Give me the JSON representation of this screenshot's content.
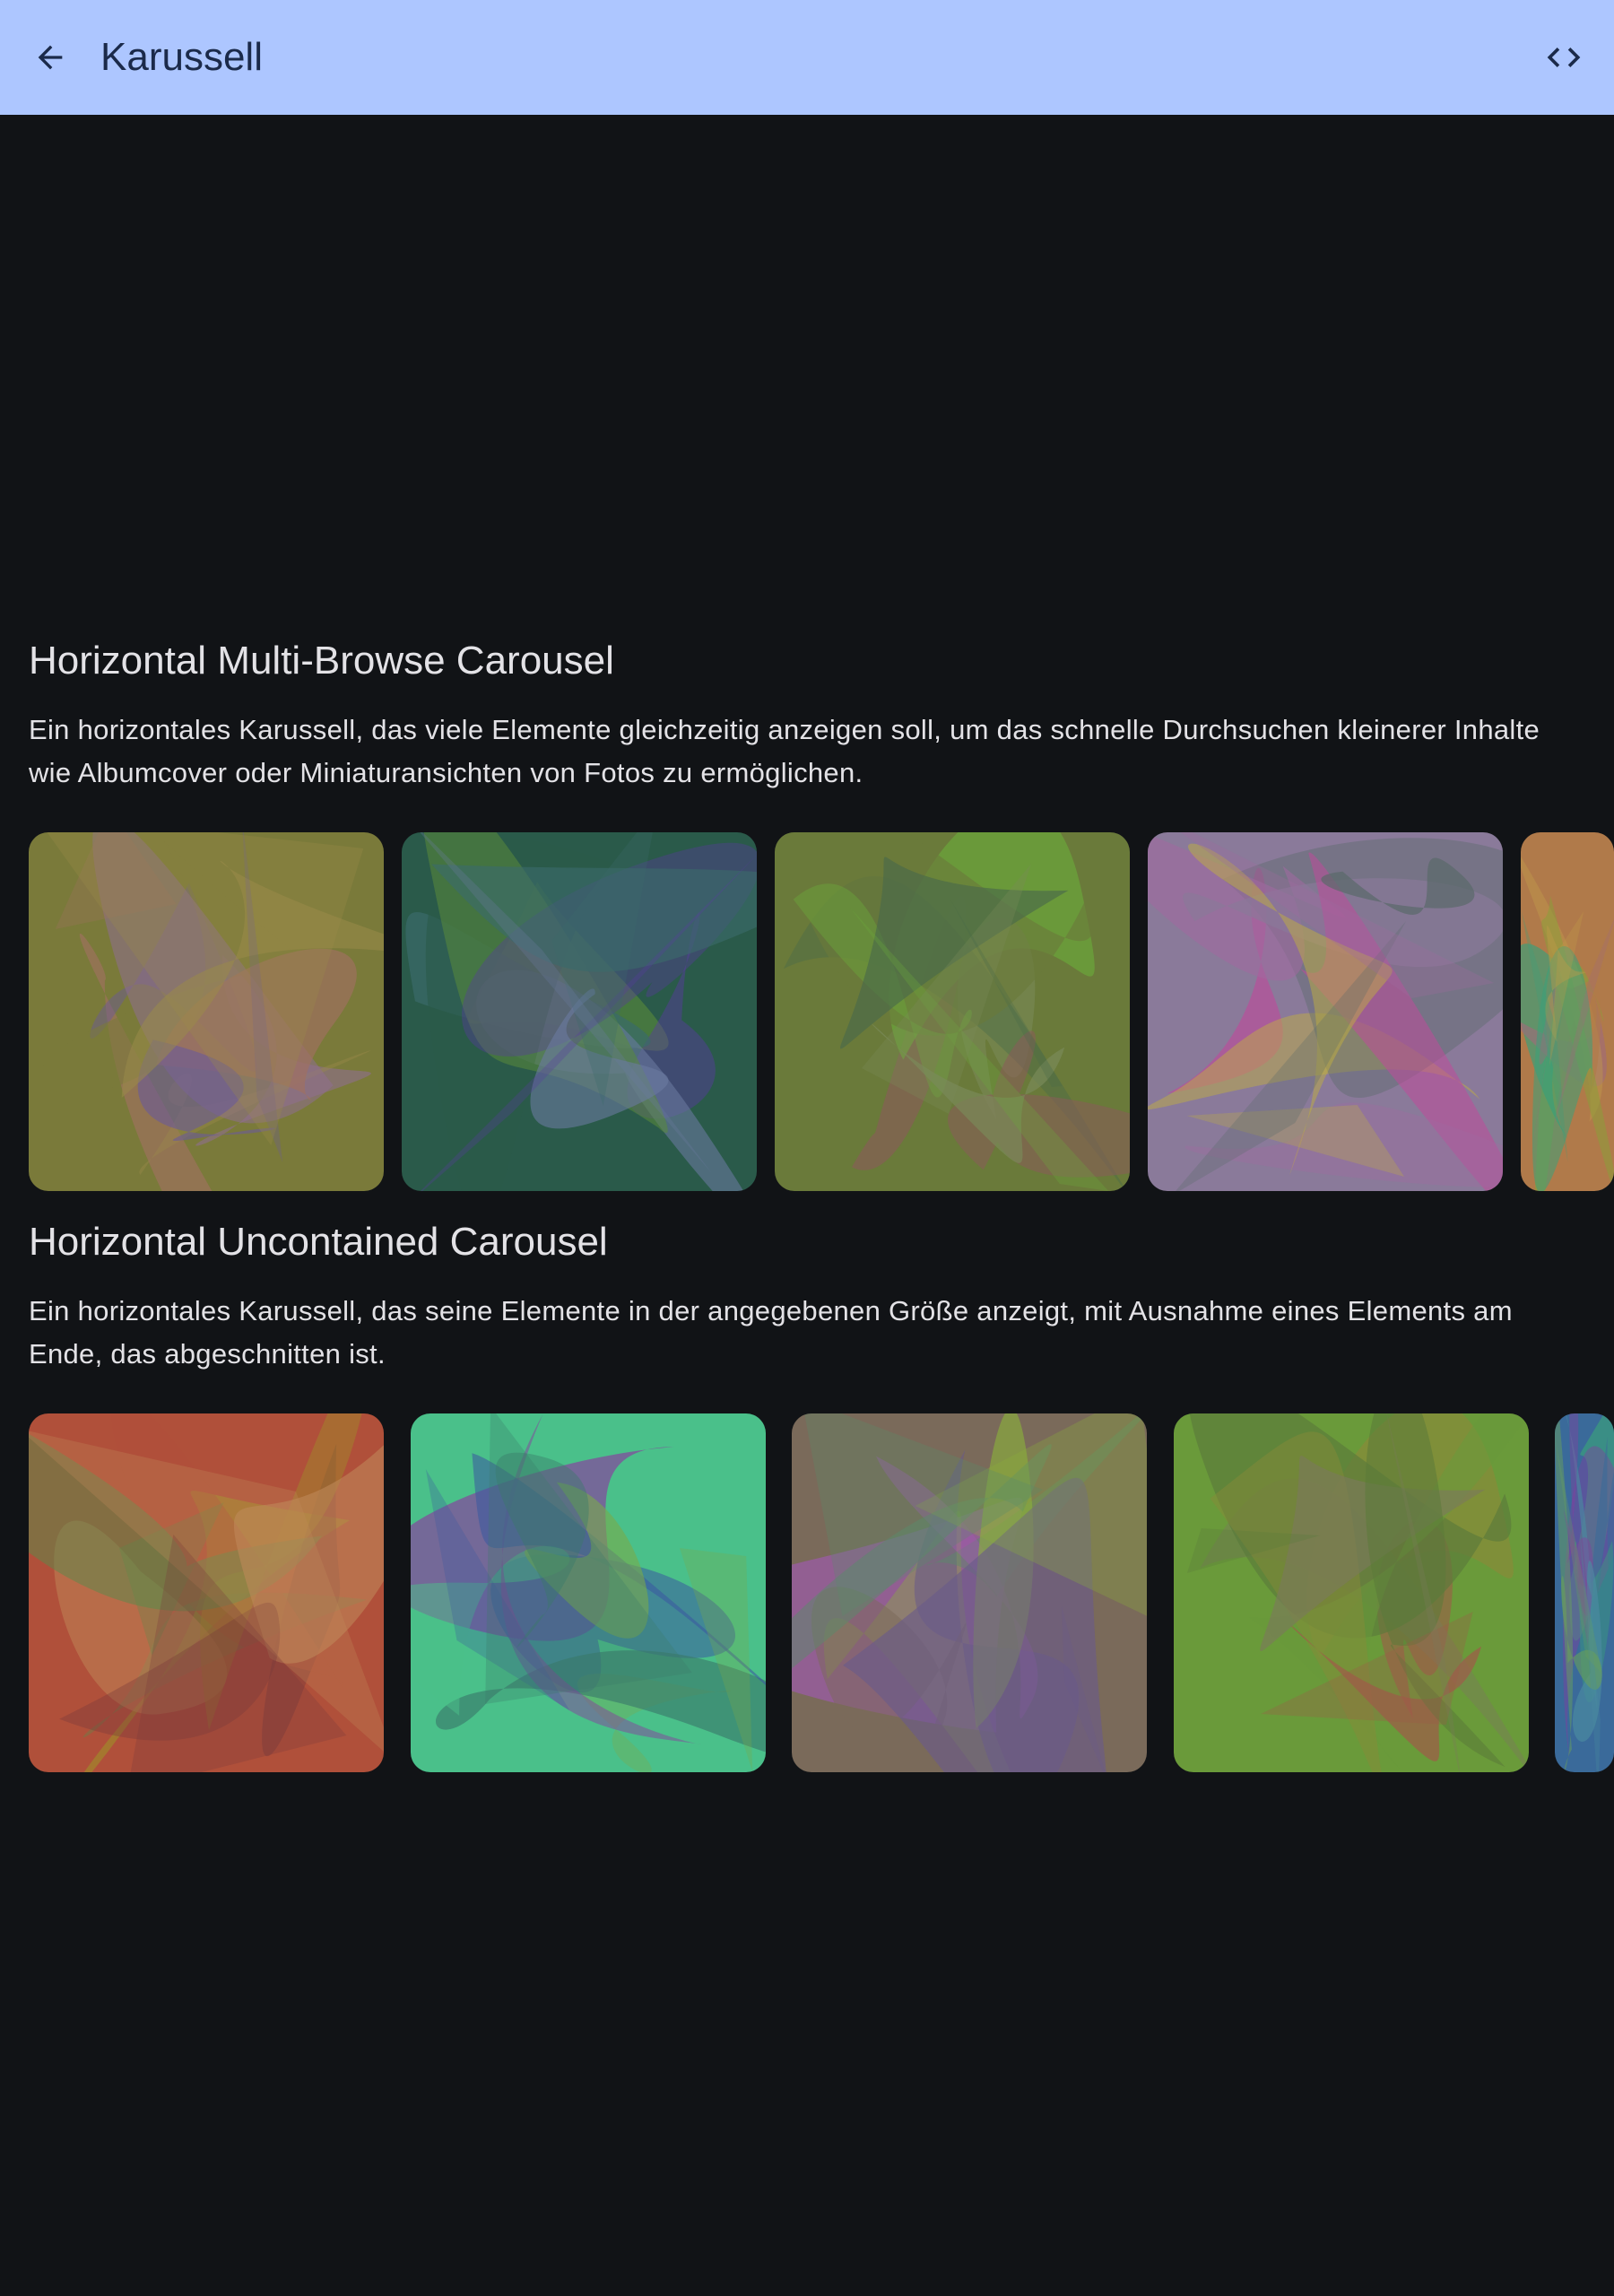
{
  "app_bar": {
    "title": "Karussell",
    "back_icon": "arrow-back-icon",
    "code_icon": "code-icon",
    "background": "#adc6ff"
  },
  "sections": [
    {
      "title": "Horizontal Multi-Browse Carousel",
      "description": "Ein horizontales Karussell, das viele Elemente gleichzeitig anzeigen soll, um das schnelle Durchsuchen kleinerer Inhalte wie Albumcover oder Miniaturansichten von Fotos zu ermöglichen.",
      "items": [
        {
          "name": "abstract-image-1",
          "colors": [
            "#7a7a3a",
            "#8f6f8f",
            "#a07060",
            "#6a5a9a",
            "#9a8a4a"
          ]
        },
        {
          "name": "abstract-image-2",
          "colors": [
            "#2a5a4a",
            "#5a8a3a",
            "#5a3aa0",
            "#3a6a6a",
            "#6a7aa0"
          ]
        },
        {
          "name": "abstract-image-3",
          "colors": [
            "#6a7a3a",
            "#8a5a5a",
            "#6aaa3a",
            "#7a8a5a",
            "#4a6a4a"
          ]
        },
        {
          "name": "abstract-image-4",
          "colors": [
            "#8a7a9a",
            "#c04a9a",
            "#c0b040",
            "#5a6a6a",
            "#a06aa0"
          ]
        },
        {
          "name": "abstract-image-5",
          "colors": [
            "#b07a4a",
            "#8aa03a",
            "#3aa07a",
            "#a06a7a",
            "#c09a4a"
          ]
        }
      ]
    },
    {
      "title": "Horizontal Uncontained Carousel",
      "description": "Ein horizontales Karussell, das seine Elemente in der angegebenen Größe anzeigt, mit Ausnahme eines Elements am Ende, das abgeschnitten ist.",
      "items": [
        {
          "name": "abstract-image-6",
          "colors": [
            "#b0503a",
            "#a08a2a",
            "#5a8a4a",
            "#c08a5a",
            "#7a3a3a"
          ]
        },
        {
          "name": "abstract-image-7",
          "colors": [
            "#4ac08a",
            "#8a3aa0",
            "#3a5aa0",
            "#7aaa4a",
            "#3a7a6a"
          ]
        },
        {
          "name": "abstract-image-8",
          "colors": [
            "#7a6a5a",
            "#a05ab0",
            "#8ab03a",
            "#6a5a8a",
            "#5a8a6a"
          ]
        },
        {
          "name": "abstract-image-9",
          "colors": [
            "#6a9a3a",
            "#8a8a3a",
            "#a05a4a",
            "#7a7a5a",
            "#5a7a3a"
          ]
        },
        {
          "name": "abstract-image-10",
          "colors": [
            "#3a6a9a",
            "#3aa07a",
            "#8a3aa0",
            "#4a8aa0",
            "#6aa05a"
          ]
        }
      ]
    }
  ]
}
